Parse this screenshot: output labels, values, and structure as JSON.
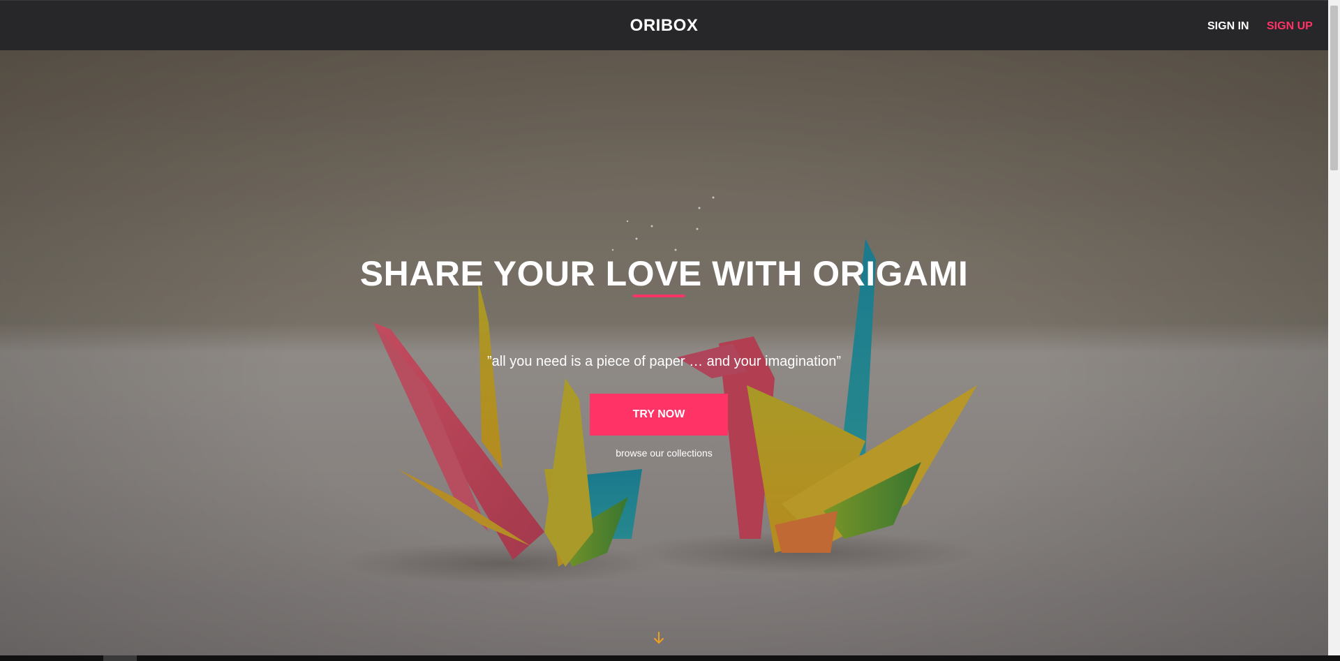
{
  "header": {
    "brand": "ORIBOX",
    "sign_in": "SIGN IN",
    "sign_up": "SIGN UP"
  },
  "hero": {
    "headline": "SHARE YOUR LOVE WITH ORIGAMI",
    "tagline": "”all you need is a piece of paper … and your imagination”",
    "cta_label": "TRY NOW",
    "browse_label": "browse our collections",
    "background_image": "origami-cranes-photo",
    "scroll_icon": "arrow-down-icon"
  },
  "colors": {
    "accent": "#ff3366",
    "navbar": "#27272a",
    "text": "#ffffff",
    "scroll_arrow": "#f0a020"
  }
}
